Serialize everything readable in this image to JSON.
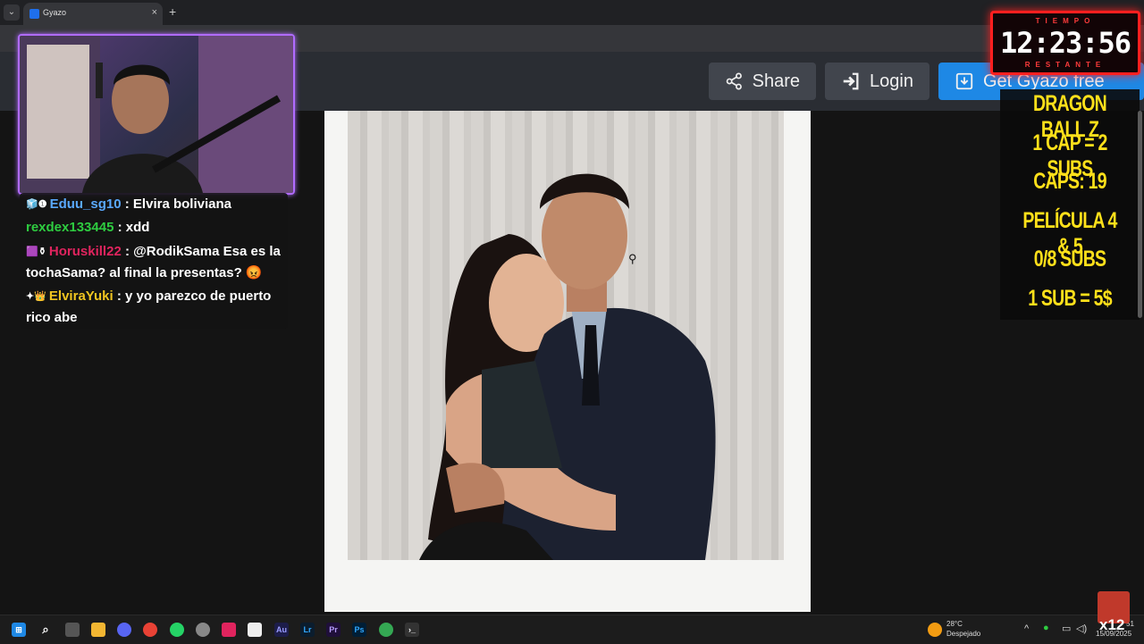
{
  "browser": {
    "tab_title": "Gyazo",
    "tab_close": "×",
    "new_tab": "+",
    "tab_menu": "⌄"
  },
  "header": {
    "share_label": "Share",
    "login_label": "Login",
    "get_label": "Get Gyazo free"
  },
  "viewer": {
    "cursor": "⚲"
  },
  "chat": {
    "messages": [
      {
        "badges": "🧊❶",
        "user": "Eduu_sg10",
        "user_color": "#5aa9ff",
        "text": ": Elvira boliviana"
      },
      {
        "badges": "",
        "user": "rexdex133445",
        "user_color": "#2ecc40",
        "text": ": xdd"
      },
      {
        "badges": "🟪⚱",
        "user": "Horuskill22",
        "user_color": "#e0245e",
        "text": ": @RodikSama Esa es la tochaSama? al final la presentas? 😡"
      },
      {
        "badges": "✦👑",
        "user": "ElviraYuki",
        "user_color": "#f0c420",
        "text": ": y yo parezco de puerto rico abe"
      }
    ]
  },
  "timer": {
    "top_label": "TIEMPO",
    "time": "12:23:56",
    "bottom_label": "RESTANTE"
  },
  "goals": {
    "lines": [
      "DRAGON BALL Z",
      "1 CAP = 2 SUBS",
      "CAPS: 19",
      "PELÍCULA 4 & 5",
      "0/8 SUBS",
      "1 SUB = 5$"
    ]
  },
  "taskbar": {
    "weather_temp": "28°C",
    "weather_desc": "Despejado",
    "clock_time": "51",
    "clock_date": "15/09/2025",
    "avatar_text": "x12",
    "icons": [
      "start-icon",
      "search-icon",
      "taskview-icon",
      "explorer-icon",
      "discord-icon",
      "chrome-icon",
      "whatsapp-icon",
      "settings-icon",
      "tiktok-icon",
      "capcut-icon",
      "audition-icon",
      "lightroom-icon",
      "premiere-icon",
      "photoshop-icon",
      "chrome-active-icon",
      "terminal-icon"
    ],
    "icon_labels": {
      "audition": "Au",
      "lightroom": "Lr",
      "premiere": "Pr",
      "photoshop": "Ps"
    }
  },
  "colors": {
    "accent_blue": "#1e88e5",
    "timer_red": "#ff1f1f",
    "goal_yellow": "#ffe01a",
    "webcam_border": "#b06bff"
  }
}
